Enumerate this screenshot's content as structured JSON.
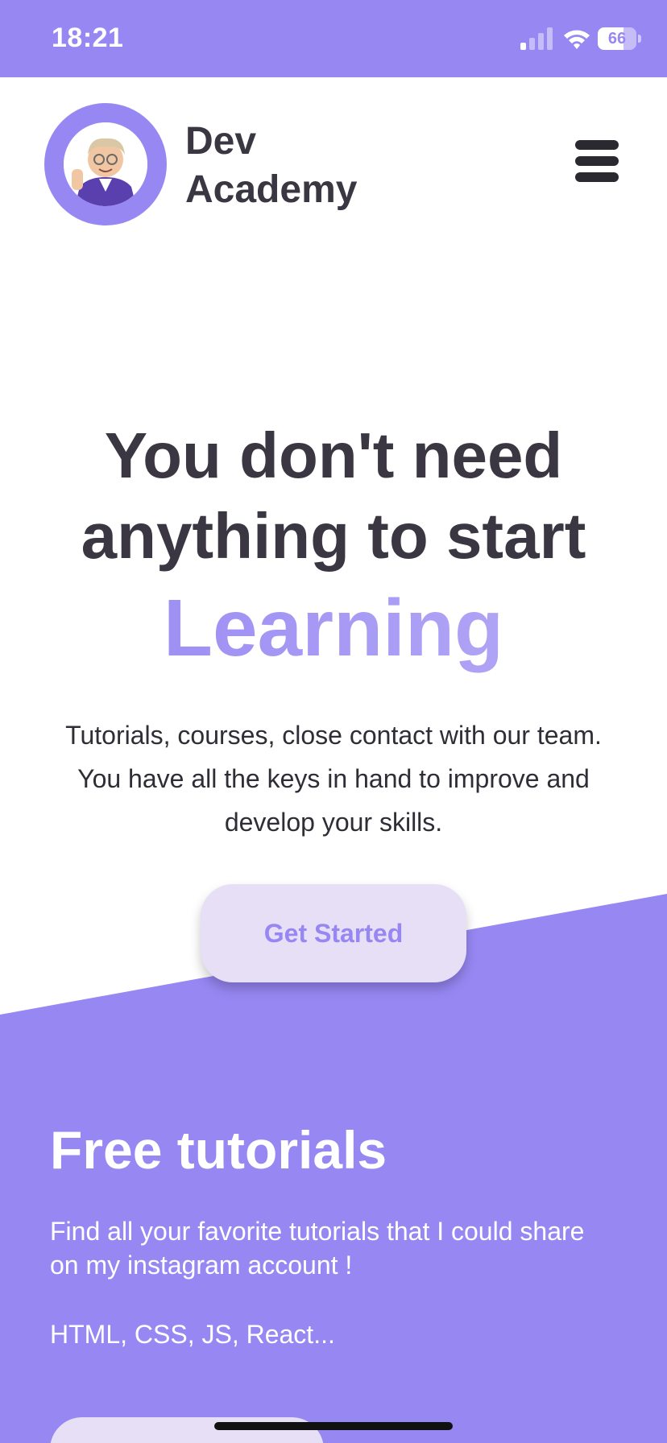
{
  "status_bar": {
    "time": "18:21",
    "battery_level": "66",
    "battery_fraction": 0.66,
    "icons": [
      "signal-icon",
      "wifi-icon",
      "battery-icon"
    ]
  },
  "header": {
    "brand_line1": "Dev",
    "brand_line2": "Academy",
    "avatar": "memoji-avatar",
    "menu_icon": "hamburger-menu-icon"
  },
  "hero": {
    "title_line1": "You don't need",
    "title_line2": "anything to start",
    "highlight": "Learning",
    "description": "Tutorials, courses, close contact with our team. You have all the keys in hand to improve and develop your skills.",
    "cta_label": "Get Started"
  },
  "tutorials": {
    "title": "Free tutorials",
    "description": "Find all your favorite tutorials that I could share on my instagram account !",
    "tags": "HTML, CSS, JS, React..."
  },
  "colors": {
    "accent": "#9787f3",
    "text_dark": "#3a3742",
    "button_light": "#e7dff6",
    "white": "#ffffff"
  }
}
